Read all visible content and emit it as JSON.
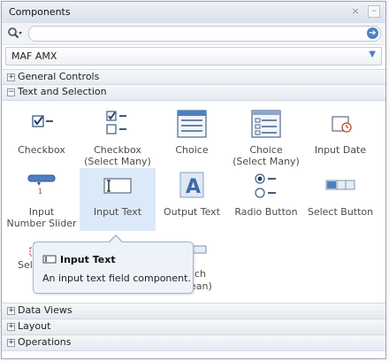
{
  "panel": {
    "title": "Components",
    "close_glyph": "×",
    "min_glyph": "–"
  },
  "search": {
    "placeholder": "",
    "go_glyph": "➔"
  },
  "library_select": {
    "value": "MAF AMX"
  },
  "categories": {
    "general_controls": {
      "label": "General Controls",
      "toggle": "+"
    },
    "text_selection": {
      "label": "Text and Selection",
      "toggle": "−"
    },
    "data_views": {
      "label": "Data Views",
      "toggle": "+"
    },
    "layout": {
      "label": "Layout",
      "toggle": "+"
    },
    "operations": {
      "label": "Operations",
      "toggle": "+"
    }
  },
  "items": [
    {
      "label": "Checkbox",
      "icon": "checkbox-icon"
    },
    {
      "label": "Checkbox\n(Select Many)",
      "icon": "checkbox-select-many-icon"
    },
    {
      "label": "Choice",
      "icon": "choice-icon"
    },
    {
      "label": "Choice\n(Select Many)",
      "icon": "choice-select-many-icon"
    },
    {
      "label": "Input Date",
      "icon": "input-date-icon"
    },
    {
      "label": "Input\nNumber Slider",
      "icon": "number-slider-icon"
    },
    {
      "label": "Input Text",
      "icon": "input-text-icon",
      "selected": true
    },
    {
      "label": "Output Text",
      "icon": "output-text-icon"
    },
    {
      "label": "Radio Button",
      "icon": "radio-button-icon"
    },
    {
      "label": "Select Button",
      "icon": "select-button-icon"
    }
  ],
  "row3_partial": {
    "left_text": "Sele",
    "right_text_top": "ch",
    "right_text_bottom": "ean)"
  },
  "tooltip": {
    "title": "Input Text",
    "description": "An input text field component."
  },
  "colors": {
    "accent": "#4f7fc0",
    "selection": "#dce9f8",
    "tooltip_bg": "#eef3fa"
  }
}
